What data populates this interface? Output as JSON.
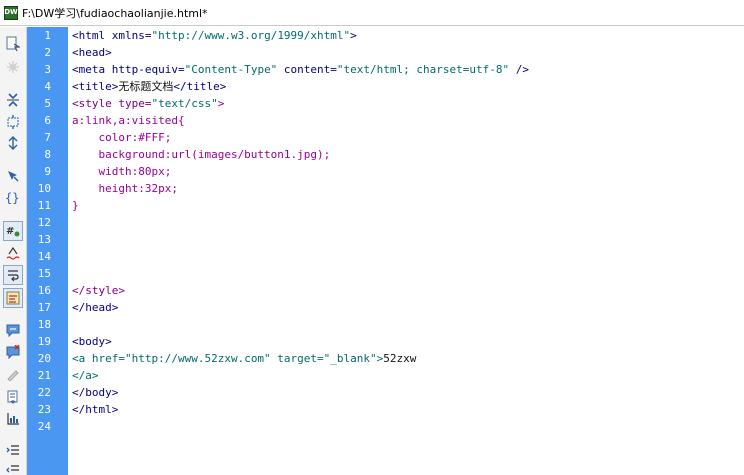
{
  "window": {
    "title": "F:\\DW学习\\fudiaochaolianjie.html*",
    "app_icon_text": "DW"
  },
  "toolbar": {
    "tools": [
      {
        "name": "open-documents-icon"
      },
      {
        "name": "show-code-navigator-icon"
      },
      {
        "name": "collapse-full-tag-icon"
      },
      {
        "name": "collapse-selection-icon"
      },
      {
        "name": "expand-all-icon"
      },
      {
        "name": "select-parent-tag-icon"
      },
      {
        "name": "balance-braces-icon"
      },
      {
        "name": "line-numbers-icon"
      },
      {
        "name": "highlight-invalid-code-icon"
      },
      {
        "name": "word-wrap-icon"
      },
      {
        "name": "syntax-coloring-icon"
      },
      {
        "name": "apply-comment-icon"
      },
      {
        "name": "remove-comment-icon"
      },
      {
        "name": "wrap-tag-icon"
      },
      {
        "name": "recent-snippets-icon"
      },
      {
        "name": "move-css-icon"
      },
      {
        "name": "indent-code-icon"
      },
      {
        "name": "outdent-code-icon"
      }
    ]
  },
  "editor": {
    "line_numbers": [
      "1",
      "2",
      "3",
      "4",
      "5",
      "6",
      "7",
      "8",
      "9",
      "10",
      "11",
      "12",
      "13",
      "14",
      "15",
      "16",
      "17",
      "18",
      "19",
      "20",
      "21",
      "22",
      "23",
      "24"
    ],
    "lines": [
      {
        "no": "1",
        "segments": [
          {
            "t": "<html xmlns=",
            "c": "c-blue"
          },
          {
            "t": "\"http://www.w3.org/1999/xhtml\"",
            "c": "c-teal"
          },
          {
            "t": ">",
            "c": "c-blue"
          }
        ]
      },
      {
        "no": "2",
        "segments": [
          {
            "t": "<head>",
            "c": "c-blue"
          }
        ]
      },
      {
        "no": "3",
        "segments": [
          {
            "t": "<meta http-equiv=",
            "c": "c-blue"
          },
          {
            "t": "\"Content-Type\"",
            "c": "c-teal"
          },
          {
            "t": " content=",
            "c": "c-blue"
          },
          {
            "t": "\"text/html; charset=utf-8\"",
            "c": "c-teal"
          },
          {
            "t": " />",
            "c": "c-blue"
          }
        ]
      },
      {
        "no": "4",
        "segments": [
          {
            "t": "<title>",
            "c": "c-blue"
          },
          {
            "t": "无标题文档",
            "c": "c-ink"
          },
          {
            "t": "</title>",
            "c": "c-blue"
          }
        ]
      },
      {
        "no": "5",
        "segments": [
          {
            "t": "<style type=",
            "c": "c-purple"
          },
          {
            "t": "\"text/css\"",
            "c": "c-teal"
          },
          {
            "t": ">",
            "c": "c-purple"
          }
        ]
      },
      {
        "no": "6",
        "segments": [
          {
            "t": "a:link,a:visited{",
            "c": "c-css"
          }
        ]
      },
      {
        "no": "7",
        "segments": [
          {
            "t": "    color:#FFF;",
            "c": "c-css"
          }
        ]
      },
      {
        "no": "8",
        "segments": [
          {
            "t": "    background:url(images/button1.jpg);",
            "c": "c-css"
          }
        ]
      },
      {
        "no": "9",
        "segments": [
          {
            "t": "    width:80px;",
            "c": "c-css"
          }
        ]
      },
      {
        "no": "10",
        "segments": [
          {
            "t": "    height:32px;",
            "c": "c-css"
          }
        ]
      },
      {
        "no": "11",
        "segments": [
          {
            "t": "}",
            "c": "c-css"
          }
        ]
      },
      {
        "no": "16",
        "segments": [
          {
            "t": "</style>",
            "c": "c-purple"
          }
        ]
      },
      {
        "no": "17",
        "segments": [
          {
            "t": "</head>",
            "c": "c-blue"
          }
        ]
      },
      {
        "no": "19",
        "segments": [
          {
            "t": "<body>",
            "c": "c-blue"
          }
        ]
      },
      {
        "no": "20",
        "segments": [
          {
            "t": "<a href=",
            "c": "c-teal"
          },
          {
            "t": "\"http://www.52zxw.com\"",
            "c": "c-teal"
          },
          {
            "t": " target=",
            "c": "c-teal"
          },
          {
            "t": "\"_blank\"",
            "c": "c-teal"
          },
          {
            "t": ">",
            "c": "c-teal"
          },
          {
            "t": "52zxw",
            "c": "c-ink"
          }
        ]
      },
      {
        "no": "21",
        "segments": [
          {
            "t": "</a>",
            "c": "c-teal"
          }
        ]
      },
      {
        "no": "22",
        "segments": [
          {
            "t": "</body>",
            "c": "c-blue"
          }
        ]
      },
      {
        "no": "23",
        "segments": [
          {
            "t": "</html>",
            "c": "c-blue"
          }
        ]
      }
    ]
  }
}
